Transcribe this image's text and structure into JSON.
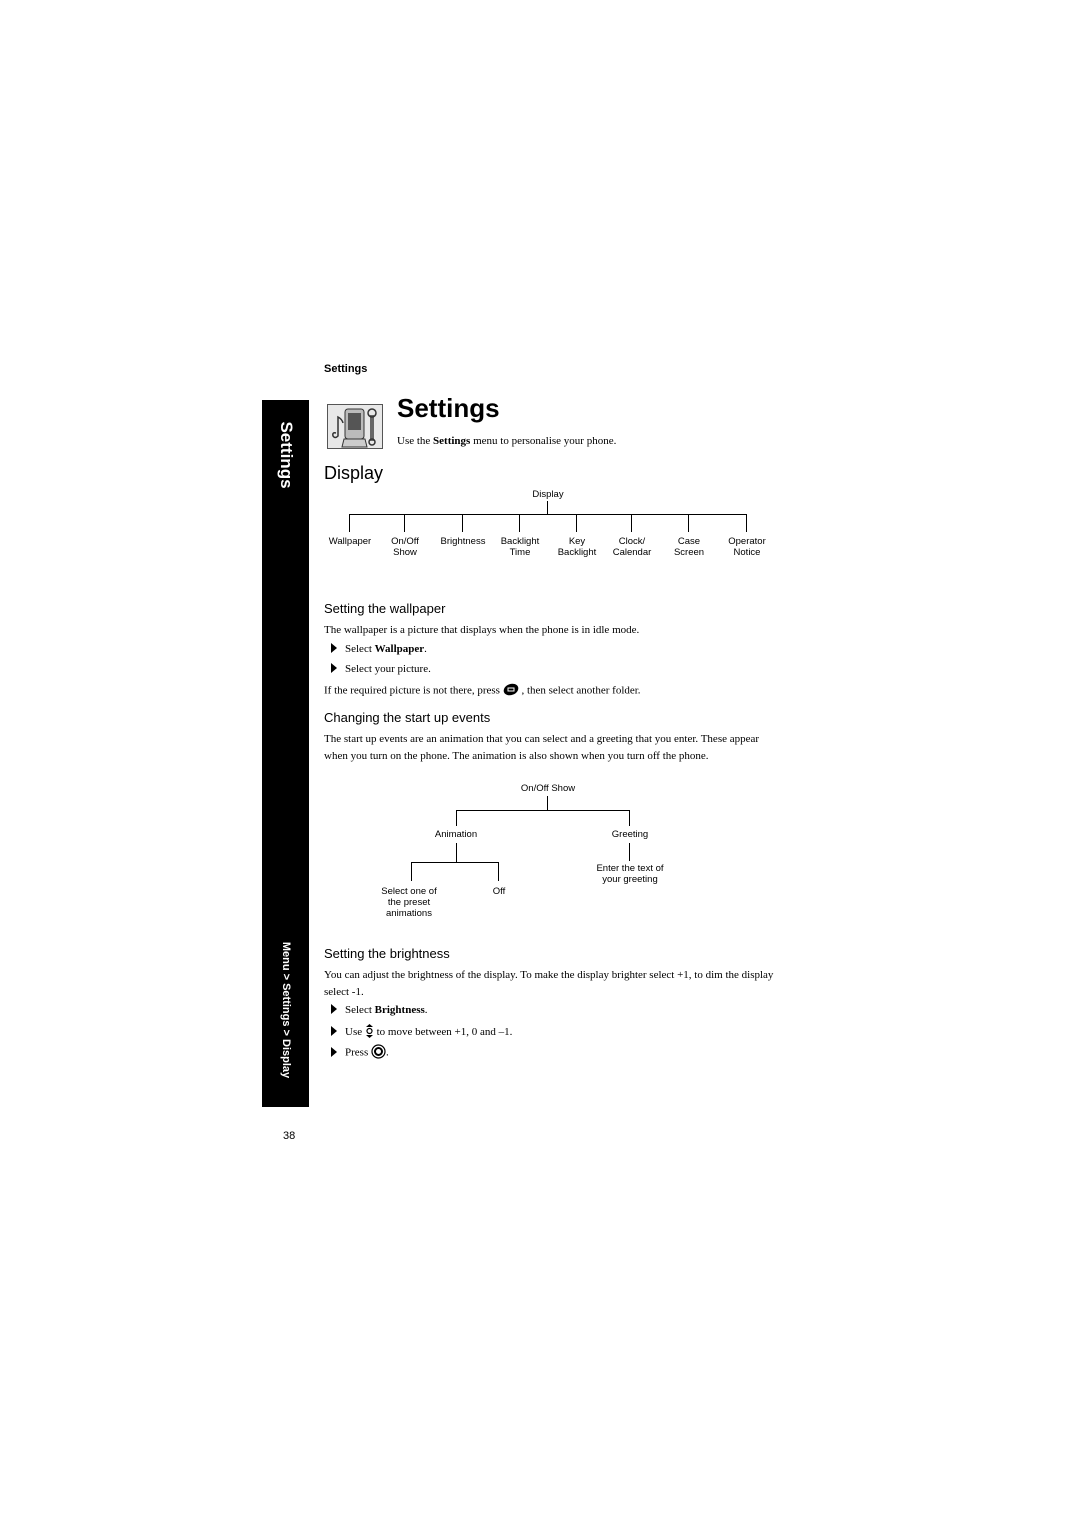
{
  "running_head": "Settings",
  "side_tab": {
    "title": "Settings",
    "path": "Menu > Settings > Display"
  },
  "header": {
    "title": "Settings",
    "icon": "settings-phone-icon",
    "intro_before": "Use the ",
    "intro_bold": "Settings",
    "intro_after": " menu to personalise your phone."
  },
  "section": {
    "title": "Display"
  },
  "display_tree": {
    "root": "Display",
    "children": [
      [
        "Wallpaper"
      ],
      [
        "On/Off",
        "Show"
      ],
      [
        "Brightness"
      ],
      [
        "Backlight",
        "Time"
      ],
      [
        "Key",
        "Backlight"
      ],
      [
        "Clock/",
        "Calendar"
      ],
      [
        "Case",
        "Screen"
      ],
      [
        "Operator",
        "Notice"
      ]
    ]
  },
  "wallpaper": {
    "title": "Setting the wallpaper",
    "para": "The wallpaper is a picture that displays when the phone is in idle mode.",
    "step1_pre": "Select ",
    "step1_bold": "Wallpaper",
    "step1_post": ".",
    "step2": "Select your picture.",
    "note_pre": "If the required picture is not there, press ",
    "note_icon": "soft-key-icon",
    "note_post": " , then select another folder."
  },
  "startup": {
    "title": "Changing the start up events",
    "para": "The start up events are an animation that you can select and a greeting that you enter. These appear when you turn on the phone. The animation is also shown when you turn off the phone.",
    "tree": {
      "root": "On/Off Show",
      "animation": "Animation",
      "greeting": "Greeting",
      "select_line1": "Select one of",
      "select_line2": "the preset",
      "select_line3": "animations",
      "off": "Off",
      "greeting_line1": "Enter the text of",
      "greeting_line2": "your greeting"
    }
  },
  "brightness": {
    "title": "Setting the brightness",
    "para": "You can adjust the brightness of the display. To make the display brighter select +1, to dim the display select -1.",
    "step1_pre": "Select ",
    "step1_bold": "Brightness",
    "step1_post": ".",
    "step2_pre": "Use ",
    "step2_icon": "navigation-key-icon",
    "step2_post": " to move between +1, 0 and –1.",
    "step3_pre": "Press ",
    "step3_icon": "ok-key-icon",
    "step3_post": "."
  },
  "page_number": "38"
}
